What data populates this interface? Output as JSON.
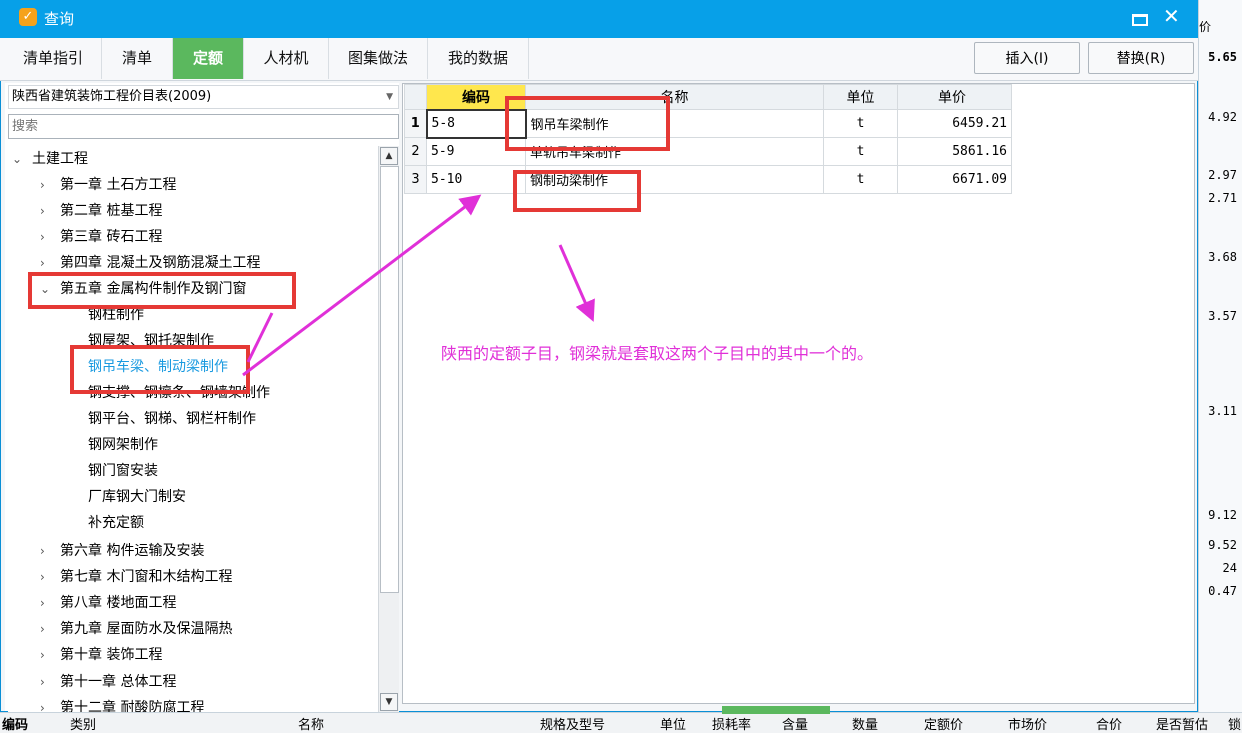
{
  "background": {
    "header_label": "价",
    "right_values": [
      "5.65",
      "4.92",
      "2.97",
      "2.71",
      "3.68",
      "3.57",
      "3.11",
      "9.12",
      "9.52",
      "24",
      "0.47"
    ],
    "bottom_headers": [
      "编码",
      "类别",
      "名称",
      "规格及型号",
      "单位",
      "损耗率",
      "含量",
      "数量",
      "定额价",
      "市场价",
      "合价",
      "是否暂估",
      "锁"
    ]
  },
  "dialog": {
    "title": "查询",
    "tabs": [
      "清单指引",
      "清单",
      "定额",
      "人材机",
      "图集做法",
      "我的数据"
    ],
    "active_tab": "定额",
    "insert_button": "插入(I)",
    "replace_button": "替换(R)",
    "accent_color": "#07a0e8",
    "active_tab_color": "#5bb85e"
  },
  "left": {
    "library": "陕西省建筑装饰工程价目表(2009)",
    "search_placeholder": "搜索",
    "tree": [
      {
        "label": "土建工程",
        "arrow": "⌄",
        "level": 0
      },
      {
        "label": "第一章 土石方工程",
        "arrow": "›",
        "level": 1
      },
      {
        "label": "第二章 桩基工程",
        "arrow": "›",
        "level": 1
      },
      {
        "label": "第三章 砖石工程",
        "arrow": "›",
        "level": 1
      },
      {
        "label": "第四章 混凝土及钢筋混凝土工程",
        "arrow": "›",
        "level": 1
      },
      {
        "label": "第五章 金属构件制作及钢门窗",
        "arrow": "⌄",
        "level": 1
      },
      {
        "label": "钢柱制作",
        "level": 2
      },
      {
        "label": "钢屋架、钢托架制作",
        "level": 2
      },
      {
        "label": "钢吊车梁、制动梁制作",
        "level": 2,
        "selected": true
      },
      {
        "label": "钢支撑、钢檩条、钢墙架制作",
        "level": 2
      },
      {
        "label": "钢平台、钢梯、钢栏杆制作",
        "level": 2
      },
      {
        "label": "钢网架制作",
        "level": 2
      },
      {
        "label": "钢门窗安装",
        "level": 2
      },
      {
        "label": "厂库钢大门制安",
        "level": 2
      },
      {
        "label": "补充定额",
        "level": 2
      },
      {
        "label": "第六章 构件运输及安装",
        "arrow": "›",
        "level": 1
      },
      {
        "label": "第七章 木门窗和木结构工程",
        "arrow": "›",
        "level": 1
      },
      {
        "label": "第八章 楼地面工程",
        "arrow": "›",
        "level": 1
      },
      {
        "label": "第九章 屋面防水及保温隔热",
        "arrow": "›",
        "level": 1
      },
      {
        "label": "第十章 装饰工程",
        "arrow": "›",
        "level": 1
      },
      {
        "label": "第十一章 总体工程",
        "arrow": "›",
        "level": 1
      },
      {
        "label": "第十二章 耐酸防腐工程",
        "arrow": "›",
        "level": 1
      }
    ]
  },
  "grid": {
    "headers": {
      "code": "编码",
      "name": "名称",
      "unit": "单位",
      "price": "单价"
    },
    "rows": [
      {
        "idx": "1",
        "code": "5-8",
        "name": "钢吊车梁制作",
        "unit": "t",
        "price": "6459.21"
      },
      {
        "idx": "2",
        "code": "5-9",
        "name": "单轨吊车梁制作",
        "unit": "t",
        "price": "5861.16"
      },
      {
        "idx": "3",
        "code": "5-10",
        "name": "钢制动梁制作",
        "unit": "t",
        "price": "6671.09"
      }
    ]
  },
  "annotation": {
    "text": "陕西的定额子目，钢梁就是套取这两个子目中的其中一个的。",
    "color": "#e030d8",
    "box_color": "#e53935"
  }
}
